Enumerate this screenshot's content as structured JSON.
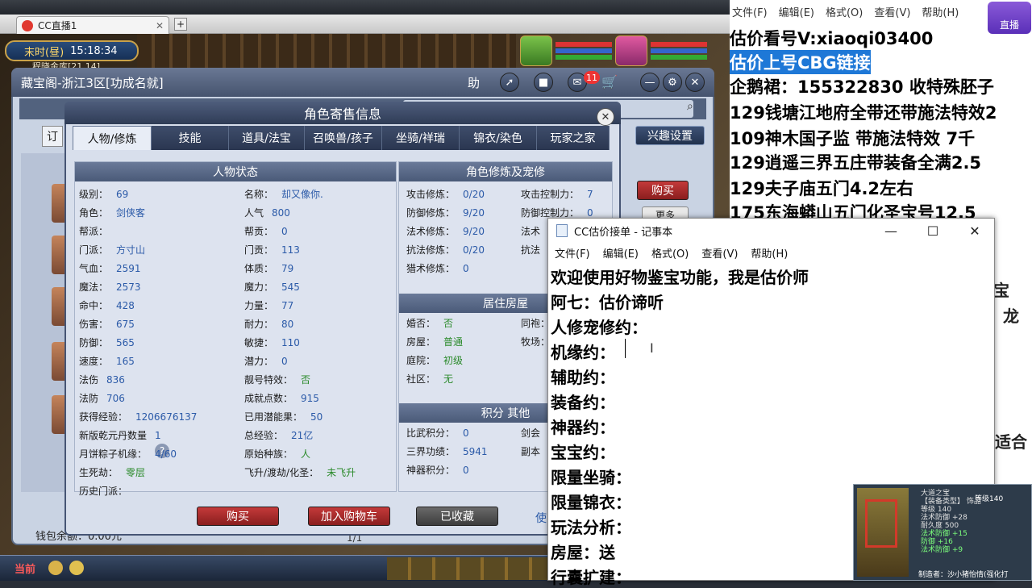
{
  "browser": {
    "tabs": [
      {
        "label": "CC直播1"
      }
    ],
    "add_tab": "+"
  },
  "game": {
    "clock": {
      "label": "末时(昼)",
      "time": "15:18:34"
    },
    "region_hint": "程晓金库[21,14]",
    "cbg_window": {
      "title": "藏宝阁-浙江3区[功成名就]",
      "help_label": "助",
      "badge_count": "11",
      "side_buy_label": "购买",
      "side_more_label": "更多",
      "interest_label": "兴趣设置",
      "order_stub": "订",
      "wallet": "钱包余额：0.00元",
      "page": "1/1"
    },
    "panel": {
      "title": "角色寄售信息",
      "tabs": [
        "人物/修炼",
        "技能",
        "道具/法宝",
        "召唤兽/孩子",
        "坐骑/祥瑞",
        "锦衣/染色",
        "玩家之家"
      ],
      "active_tab": 0,
      "char_status": {
        "heading": "人物状态",
        "left_col": [
          {
            "k": "级别：",
            "v": "69"
          },
          {
            "k": "角色：",
            "v": "剑侠客"
          },
          {
            "k": "帮派：",
            "v": ""
          },
          {
            "k": "门派：",
            "v": "方寸山"
          },
          {
            "k": "气血：",
            "v": "2591"
          },
          {
            "k": "魔法：",
            "v": "2573"
          },
          {
            "k": "命中：",
            "v": "428"
          },
          {
            "k": "伤害：",
            "v": "675"
          },
          {
            "k": "防御：",
            "v": "565"
          },
          {
            "k": "速度：",
            "v": "165"
          },
          {
            "k": "法伤",
            "v": "836"
          },
          {
            "k": "法防",
            "v": "706"
          },
          {
            "k": "获得经验：",
            "v": "1206676137"
          },
          {
            "k": "新版乾元丹数量",
            "v": "1"
          },
          {
            "k": "月饼粽子机缘：",
            "v": "4/60"
          },
          {
            "k": "生死劫：",
            "v": "零层"
          },
          {
            "k": "历史门派：",
            "v": ""
          }
        ],
        "right_col": [
          {
            "k": "名称：",
            "v": "却又像你."
          },
          {
            "k": "人气",
            "v": "800"
          },
          {
            "k": "帮贡：",
            "v": "0"
          },
          {
            "k": "门贡：",
            "v": "113"
          },
          {
            "k": "体质：",
            "v": "79"
          },
          {
            "k": "魔力：",
            "v": "545"
          },
          {
            "k": "力量：",
            "v": "77"
          },
          {
            "k": "耐力：",
            "v": "80"
          },
          {
            "k": "敏捷：",
            "v": "110"
          },
          {
            "k": "潜力：",
            "v": "0"
          },
          {
            "k": "靓号特效：",
            "v": "否"
          },
          {
            "k": "成就点数：",
            "v": "915"
          },
          {
            "k": "已用潜能果：",
            "v": "50"
          },
          {
            "k": "总经验：",
            "v": "21亿"
          },
          {
            "k": "原始种族：",
            "v": "人"
          },
          {
            "k": "飞升/渡劫/化圣：",
            "v": "未飞升"
          }
        ]
      },
      "cultivation": {
        "heading": "角色修炼及宠修",
        "left": [
          {
            "k": "攻击修炼：",
            "v": "0/20"
          },
          {
            "k": "防御修炼：",
            "v": "9/20"
          },
          {
            "k": "法术修炼：",
            "v": "9/20"
          },
          {
            "k": "抗法修炼：",
            "v": "0/20"
          },
          {
            "k": "猎术修炼：",
            "v": "0"
          }
        ],
        "right": [
          {
            "k": "攻击控制力：",
            "v": "7"
          },
          {
            "k": "防御控制力：",
            "v": "0"
          },
          {
            "k": "法术",
            "v": ""
          },
          {
            "k": "抗法",
            "v": ""
          }
        ]
      },
      "house": {
        "heading": "居住房屋",
        "left": [
          {
            "k": "婚否：",
            "v": "否"
          },
          {
            "k": "房屋：",
            "v": "普通"
          },
          {
            "k": "庭院：",
            "v": "初级"
          },
          {
            "k": "社区：",
            "v": "无"
          }
        ],
        "right": [
          {
            "k": "同袍：",
            "v": ""
          },
          {
            "k": "牧场：",
            "v": ""
          }
        ]
      },
      "score": {
        "heading": "积分 其他",
        "left": [
          {
            "k": "比武积分：",
            "v": "0"
          },
          {
            "k": "三界功绩：",
            "v": "5941"
          },
          {
            "k": "神器积分：",
            "v": "0"
          }
        ],
        "right": [
          {
            "k": "剑会",
            "v": ""
          },
          {
            "k": "副本",
            "v": ""
          }
        ]
      },
      "buttons": {
        "buy": "购买",
        "cart": "加入购物车",
        "collected": "已收藏",
        "use_stub": "使"
      }
    }
  },
  "right_notepad": {
    "menu": [
      "文件(F)",
      "编辑(E)",
      "格式(O)",
      "查看(V)",
      "帮助(H)"
    ],
    "lines": [
      "估价看号V:xiaoqi03400",
      "估价上号CBG链接",
      "企鹅裙：155322830 收特殊胚子",
      "129钱塘江地府全带还带施法特效2",
      "109神木国子监 带施法特效 7千",
      "129逍遥三界五庄带装备全满2.5",
      "129夫子庙五门4.2左右",
      "175东海蟒山五门化圣宝号12.5"
    ],
    "fragments": {
      "a": "宝",
      "b": "龙",
      "c": "适合"
    },
    "stream_logo": "直播"
  },
  "notepad": {
    "title": "CC估价接单 - 记事本",
    "menu": [
      "文件(F)",
      "编辑(E)",
      "格式(O)",
      "查看(V)",
      "帮助(H)"
    ],
    "lines": [
      "欢迎使用好物鉴宝功能，我是估价师",
      "阿七：估价谛听",
      "人修宠修约：",
      "机缘约：",
      "辅助约：",
      "装备约：",
      "神器约：",
      "宝宝约：",
      "限量坐骑：",
      "限量锦衣：",
      "玩法分析：",
      "房屋：送",
      "行囊扩建："
    ],
    "controls": {
      "min": "—",
      "max": "☐",
      "close": "✕"
    }
  },
  "tooltip": {
    "lines": [
      "大道之宝",
      "【装备类型】 饰品",
      "等级 140",
      "法术防御 +28",
      "耐久度 500",
      "法术防御 +15",
      "防御 +16",
      "法术防御 +9"
    ],
    "grade": "等级140",
    "maker": "制造者：沙小猪怡情(强化打"
  },
  "colors": {
    "panel_bg": "#d8dfec",
    "accent_red": "#c43a3a",
    "title_blue": "#2f3c56",
    "value_blue": "#2b5aa8"
  }
}
